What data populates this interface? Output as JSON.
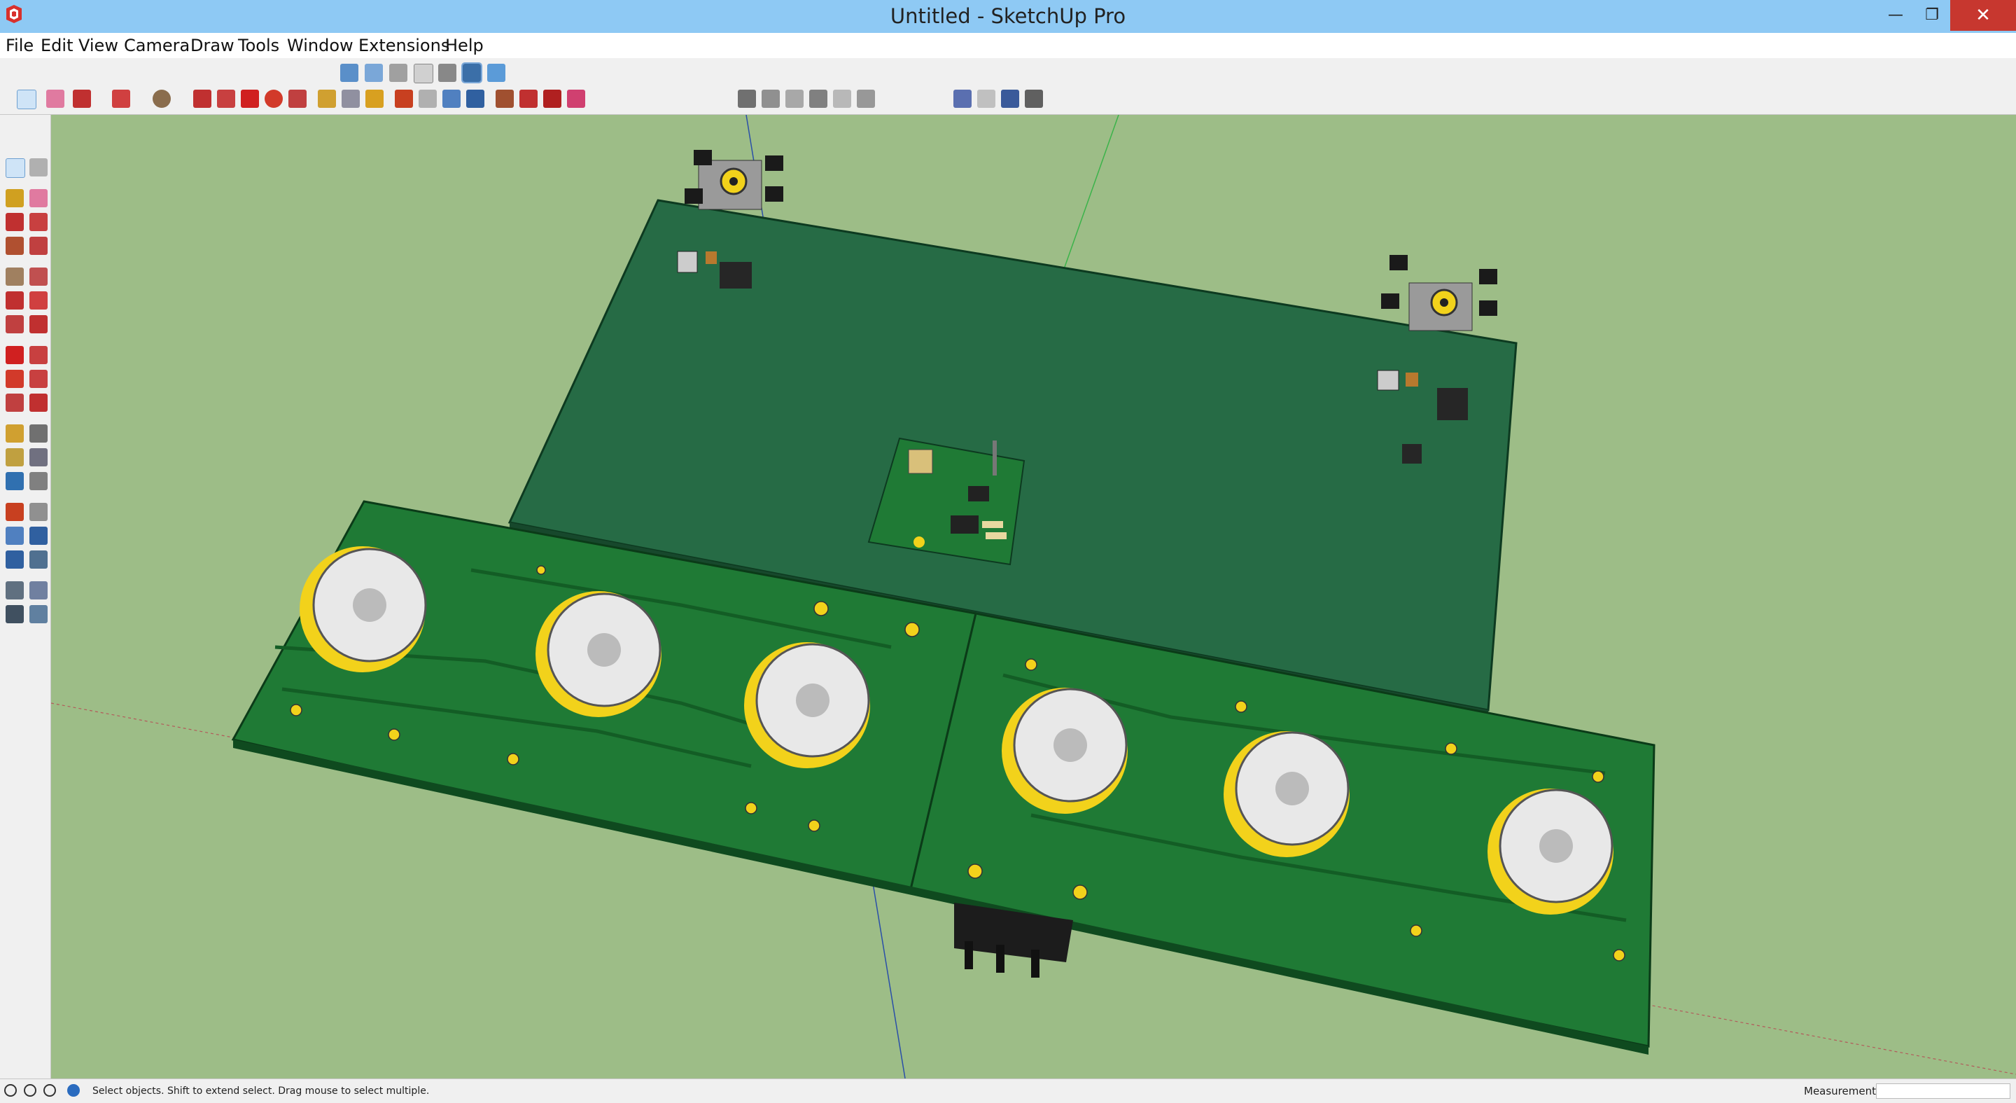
{
  "window": {
    "title": "Untitled - SketchUp Pro",
    "minimize_glyph": "—",
    "maximize_glyph": "❐",
    "close_glyph": "✕"
  },
  "menu": [
    "File",
    "Edit",
    "View",
    "Camera",
    "Draw",
    "Tools",
    "Window",
    "Extensions",
    "Help"
  ],
  "toolbar_top_icons": [
    "iso-view-icon",
    "top-view-icon",
    "front-view-icon",
    "right-view-icon",
    "back-view-icon",
    "left-view-icon",
    "bottom-view-icon"
  ],
  "toolbar_main_icons": [
    "select-icon",
    "eraser-icon",
    "line-icon",
    "arc-icon",
    "shape-icon",
    "push-pull-icon",
    "follow-me-icon",
    "move-icon",
    "rotate-icon",
    "scale-icon",
    "tape-icon",
    "text-icon",
    "paint-icon",
    "orbit-icon",
    "pan-icon",
    "zoom-icon",
    "zoom-extents-icon",
    "warehouse-icon",
    "extension-icon",
    "model-info-icon"
  ],
  "toolbar_style_icons": [
    "xray-icon",
    "wireframe-icon",
    "hidden-line-icon",
    "shaded-icon",
    "textured-icon",
    "monochrome-icon"
  ],
  "toolbar_layer_icons": [
    "sandbox-icon",
    "section-icon",
    "components-icon",
    "materials-icon"
  ],
  "side_icons": [
    "select-icon",
    "make-component-icon",
    "paint-bucket-icon",
    "eraser-icon",
    "line-icon",
    "freehand-icon",
    "rectangle-icon",
    "rotated-rectangle-icon",
    "circle-icon",
    "polygon-icon",
    "arc-icon",
    "two-point-arc-icon",
    "pie-icon",
    "three-point-arc-icon",
    "move-icon",
    "push-pull-icon",
    "rotate-icon",
    "follow-me-icon",
    "scale-icon",
    "offset-icon",
    "tape-measure-icon",
    "dimension-icon",
    "protractor-icon",
    "text-icon",
    "axes-icon",
    "3d-text-icon",
    "orbit-icon",
    "pan-icon",
    "zoom-icon",
    "zoom-window-icon",
    "zoom-extents-icon",
    "previous-view-icon",
    "position-camera-icon",
    "look-around-icon",
    "walk-icon",
    "section-plane-icon"
  ],
  "status": {
    "text": "Select objects. Shift to extend select. Drag mouse to select multiple.",
    "measurements_label": "Measurements"
  },
  "colors": {
    "title_bar": "#8ec9f4",
    "viewport_bg": "#9dbd87",
    "pcb_dark": "#266b45",
    "pcb_green": "#1f7a35",
    "pad_yellow": "#f2d21b"
  }
}
